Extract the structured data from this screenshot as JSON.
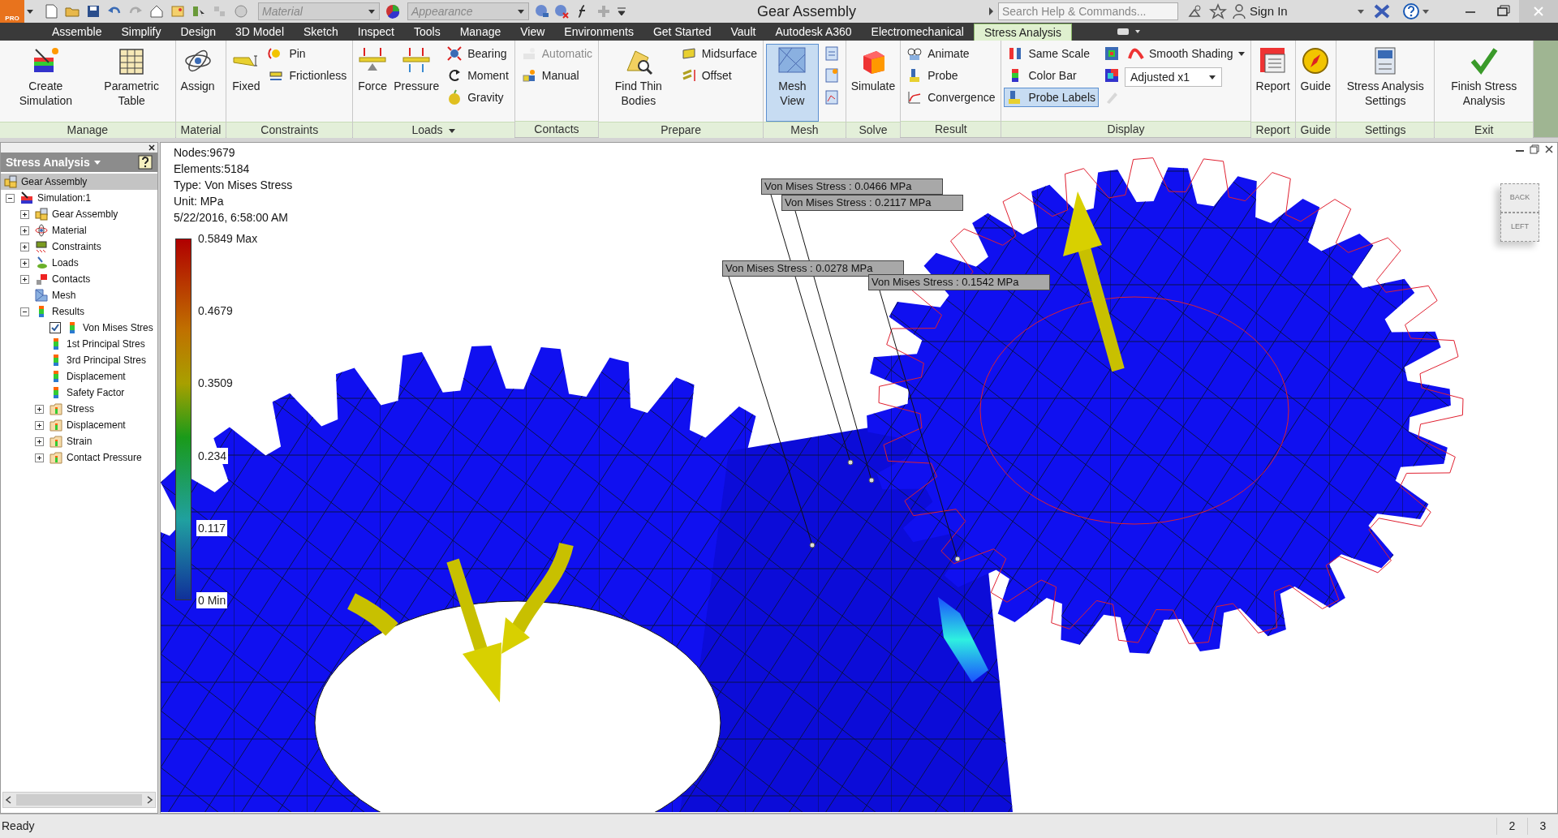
{
  "title_bar": {
    "app_badge": "PRO",
    "material": "Material",
    "appearance": "Appearance",
    "title": "Gear Assembly",
    "search_placeholder": "Search Help & Commands...",
    "sign_in": "Sign In"
  },
  "tabs": [
    {
      "label": "Assemble",
      "selected": false
    },
    {
      "label": "Simplify",
      "selected": false
    },
    {
      "label": "Design",
      "selected": false
    },
    {
      "label": "3D Model",
      "selected": false
    },
    {
      "label": "Sketch",
      "selected": false
    },
    {
      "label": "Inspect",
      "selected": false
    },
    {
      "label": "Tools",
      "selected": false
    },
    {
      "label": "Manage",
      "selected": false
    },
    {
      "label": "View",
      "selected": false
    },
    {
      "label": "Environments",
      "selected": false
    },
    {
      "label": "Get Started",
      "selected": false
    },
    {
      "label": "Vault",
      "selected": false
    },
    {
      "label": "Autodesk A360",
      "selected": false
    },
    {
      "label": "Electromechanical",
      "selected": false
    },
    {
      "label": "Stress Analysis",
      "selected": true
    }
  ],
  "ribbon_panels": [
    {
      "label": "Manage",
      "menu": false,
      "tools": [
        {
          "kind": "large",
          "label": "Create Simulation",
          "selected": false,
          "disabled": false
        },
        {
          "kind": "large",
          "label": "Parametric Table",
          "selected": false,
          "disabled": false
        }
      ]
    },
    {
      "label": "Material",
      "menu": false,
      "tools": [
        {
          "kind": "large",
          "label": "Assign",
          "selected": false,
          "disabled": false
        }
      ]
    },
    {
      "label": "Constraints",
      "menu": false,
      "tools": [
        {
          "kind": "large",
          "label": "Fixed",
          "selected": false,
          "disabled": false
        },
        {
          "kind": "small",
          "label": "Pin",
          "selected": false,
          "disabled": false
        },
        {
          "kind": "small",
          "label": "Frictionless",
          "selected": false,
          "disabled": false
        }
      ]
    },
    {
      "label": "Loads",
      "menu": true,
      "tools": [
        {
          "kind": "large",
          "label": "Force",
          "selected": false,
          "disabled": false
        },
        {
          "kind": "large",
          "label": "Pressure",
          "selected": false,
          "disabled": false
        },
        {
          "kind": "small",
          "label": "Bearing",
          "selected": false,
          "disabled": false
        },
        {
          "kind": "small",
          "label": "Moment",
          "selected": false,
          "disabled": false
        },
        {
          "kind": "small",
          "label": "Gravity",
          "selected": false,
          "disabled": false
        }
      ]
    },
    {
      "label": "Contacts",
      "menu": false,
      "tools": [
        {
          "kind": "small",
          "label": "Automatic",
          "selected": false,
          "disabled": true
        },
        {
          "kind": "small",
          "label": "Manual",
          "selected": false,
          "disabled": false
        }
      ]
    },
    {
      "label": "Prepare",
      "menu": false,
      "tools": [
        {
          "kind": "large",
          "label": "Find Thin Bodies",
          "selected": false,
          "disabled": false
        },
        {
          "kind": "small",
          "label": "Midsurface",
          "selected": false,
          "disabled": false
        },
        {
          "kind": "small",
          "label": "Offset",
          "selected": false,
          "disabled": false
        }
      ]
    },
    {
      "label": "Mesh",
      "menu": false,
      "tools": [
        {
          "kind": "large",
          "label": "Mesh View",
          "selected": true,
          "disabled": false
        },
        {
          "kind": "icon",
          "selected": false,
          "disabled": false
        },
        {
          "kind": "icon",
          "selected": false,
          "disabled": false
        },
        {
          "kind": "icon",
          "selected": false,
          "disabled": false
        }
      ]
    },
    {
      "label": "Solve",
      "menu": false,
      "tools": [
        {
          "kind": "large",
          "label": "Simulate",
          "selected": false,
          "disabled": false
        }
      ]
    },
    {
      "label": "Result",
      "menu": false,
      "tools": [
        {
          "kind": "small",
          "label": "Animate",
          "selected": false,
          "disabled": false
        },
        {
          "kind": "small",
          "label": "Probe",
          "selected": false,
          "disabled": false
        },
        {
          "kind": "small",
          "label": "Convergence",
          "selected": false,
          "disabled": false
        }
      ]
    },
    {
      "label": "Display",
      "menu": false,
      "tools": [
        {
          "kind": "small",
          "label": "Same Scale",
          "selected": false,
          "disabled": false
        },
        {
          "kind": "small",
          "label": "Color Bar",
          "selected": false,
          "disabled": false
        },
        {
          "kind": "small",
          "label": "Probe Labels",
          "selected": true,
          "disabled": false
        },
        {
          "kind": "icon",
          "selected": false,
          "disabled": false
        },
        {
          "kind": "icon",
          "selected": false,
          "disabled": false
        },
        {
          "kind": "icon",
          "selected": false,
          "disabled": true
        },
        {
          "kind": "dropdown",
          "label": "Smooth Shading",
          "selected": false,
          "disabled": false
        },
        {
          "kind": "combo",
          "label": "Adjusted x1",
          "selected": false,
          "disabled": false
        }
      ]
    },
    {
      "label": "Report",
      "menu": false,
      "tools": [
        {
          "kind": "large",
          "label": "Report",
          "selected": false,
          "disabled": false
        }
      ]
    },
    {
      "label": "Guide",
      "menu": false,
      "tools": [
        {
          "kind": "large",
          "label": "Guide",
          "selected": false,
          "disabled": false
        }
      ]
    },
    {
      "label": "Settings",
      "menu": false,
      "tools": [
        {
          "kind": "large",
          "label": "Stress Analysis Settings",
          "selected": false,
          "disabled": false
        }
      ]
    },
    {
      "label": "Exit",
      "menu": false,
      "tools": [
        {
          "kind": "large",
          "label": "Finish Stress Analysis",
          "selected": false,
          "disabled": false
        }
      ]
    }
  ],
  "browser": {
    "title": "Stress Analysis",
    "tree": [
      {
        "label": "Gear Assembly",
        "kind": "assembly",
        "selected": true,
        "children": [
          {
            "label": "Simulation:1",
            "kind": "simulation",
            "selected": false,
            "expanded": true,
            "children": [
              {
                "label": "Gear Assembly",
                "kind": "assembly",
                "selected": false,
                "expanded": false
              },
              {
                "label": "Material",
                "kind": "material",
                "selected": false,
                "expanded": false
              },
              {
                "label": "Constraints",
                "kind": "constraints",
                "selected": false,
                "expanded": false
              },
              {
                "label": "Loads",
                "kind": "loads",
                "selected": false,
                "expanded": false
              },
              {
                "label": "Contacts",
                "kind": "contacts",
                "selected": false,
                "expanded": false
              },
              {
                "label": "Mesh",
                "kind": "mesh",
                "selected": false
              },
              {
                "label": "Results",
                "kind": "result",
                "selected": false,
                "expanded": true,
                "children": [
                  {
                    "label": "Von Mises Stres",
                    "kind": "result",
                    "selected": false,
                    "checked": true
                  },
                  {
                    "label": "1st Principal Stres",
                    "kind": "result",
                    "selected": false
                  },
                  {
                    "label": "3rd Principal Stres",
                    "kind": "result",
                    "selected": false
                  },
                  {
                    "label": "Displacement",
                    "kind": "result",
                    "selected": false
                  },
                  {
                    "label": "Safety Factor",
                    "kind": "result",
                    "selected": false
                  },
                  {
                    "label": "Stress",
                    "kind": "folder",
                    "selected": false,
                    "expanded": false
                  },
                  {
                    "label": "Displacement",
                    "kind": "folder",
                    "selected": false,
                    "expanded": false
                  },
                  {
                    "label": "Strain",
                    "kind": "folder",
                    "selected": false,
                    "expanded": false
                  },
                  {
                    "label": "Contact Pressure",
                    "kind": "folder",
                    "selected": false,
                    "expanded": false
                  }
                ]
              }
            ]
          }
        ]
      }
    ]
  },
  "viewport": {
    "info": [
      "Nodes:9679",
      "Elements:5184",
      "Type: Von Mises Stress",
      "Unit: MPa",
      "5/22/2016, 6:58:00 AM"
    ],
    "legend": [
      "0.5849 Max",
      "0.4679",
      "0.3509",
      "0.234",
      "0.117",
      "0 Min"
    ],
    "probe_labels": [
      "Von Mises Stress : 0.0466 MPa",
      "Von Mises Stress : 0.2117 MPa",
      "Von Mises Stress : 0.0278 MPa",
      "Von Mises Stress : 0.1542 MPa"
    ],
    "view_cube": [
      "BACK",
      "LEFT"
    ]
  },
  "status_bar": {
    "text": "Ready",
    "fields": [
      "2",
      "3"
    ]
  }
}
